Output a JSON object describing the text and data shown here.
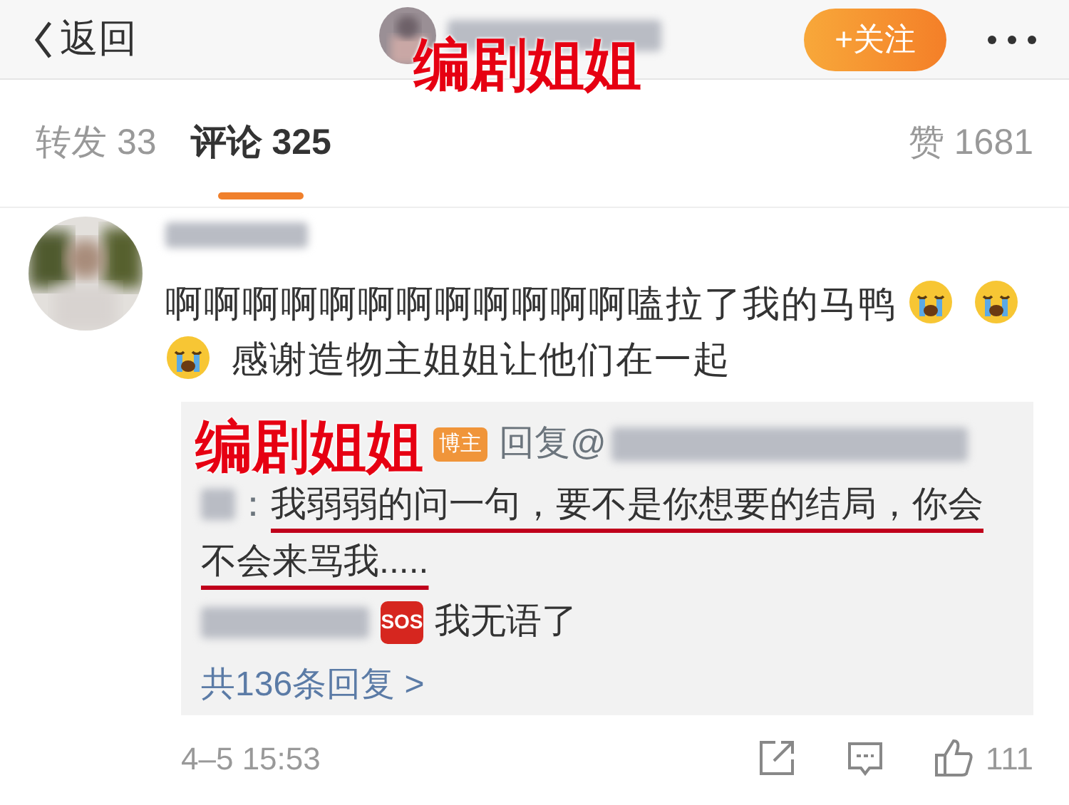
{
  "header": {
    "back_label": "返回",
    "follow_label": "+关注",
    "annotation": "编剧姐姐"
  },
  "tabs": [
    {
      "label": "转发 33",
      "selected": false
    },
    {
      "label": "评论 325",
      "selected": true
    },
    {
      "label": "赞 1681",
      "selected": false
    }
  ],
  "comment": {
    "segments": [
      {
        "kind": "text",
        "text": "啊啊啊啊啊啊啊啊啊啊啊啊嗑拉了我的马鸭"
      },
      {
        "kind": "emoji"
      },
      {
        "kind": "emoji"
      },
      {
        "kind": "emoji"
      },
      {
        "kind": "text",
        "text": "感谢造物主姐姐让他们在一起"
      }
    ]
  },
  "reply": {
    "annotation": "编剧姐姐",
    "badge": "博主",
    "reply_prefix": "回复@",
    "separator": "：",
    "text": "我弱弱的问一句，要不是你想要的结局，你会不会来骂我.....",
    "sub_reply": {
      "badge": "SOS",
      "text": "我无语了"
    },
    "more_link": "共136条回复 >"
  },
  "footer": {
    "time": "4–5 15:53",
    "like_count": "111"
  }
}
